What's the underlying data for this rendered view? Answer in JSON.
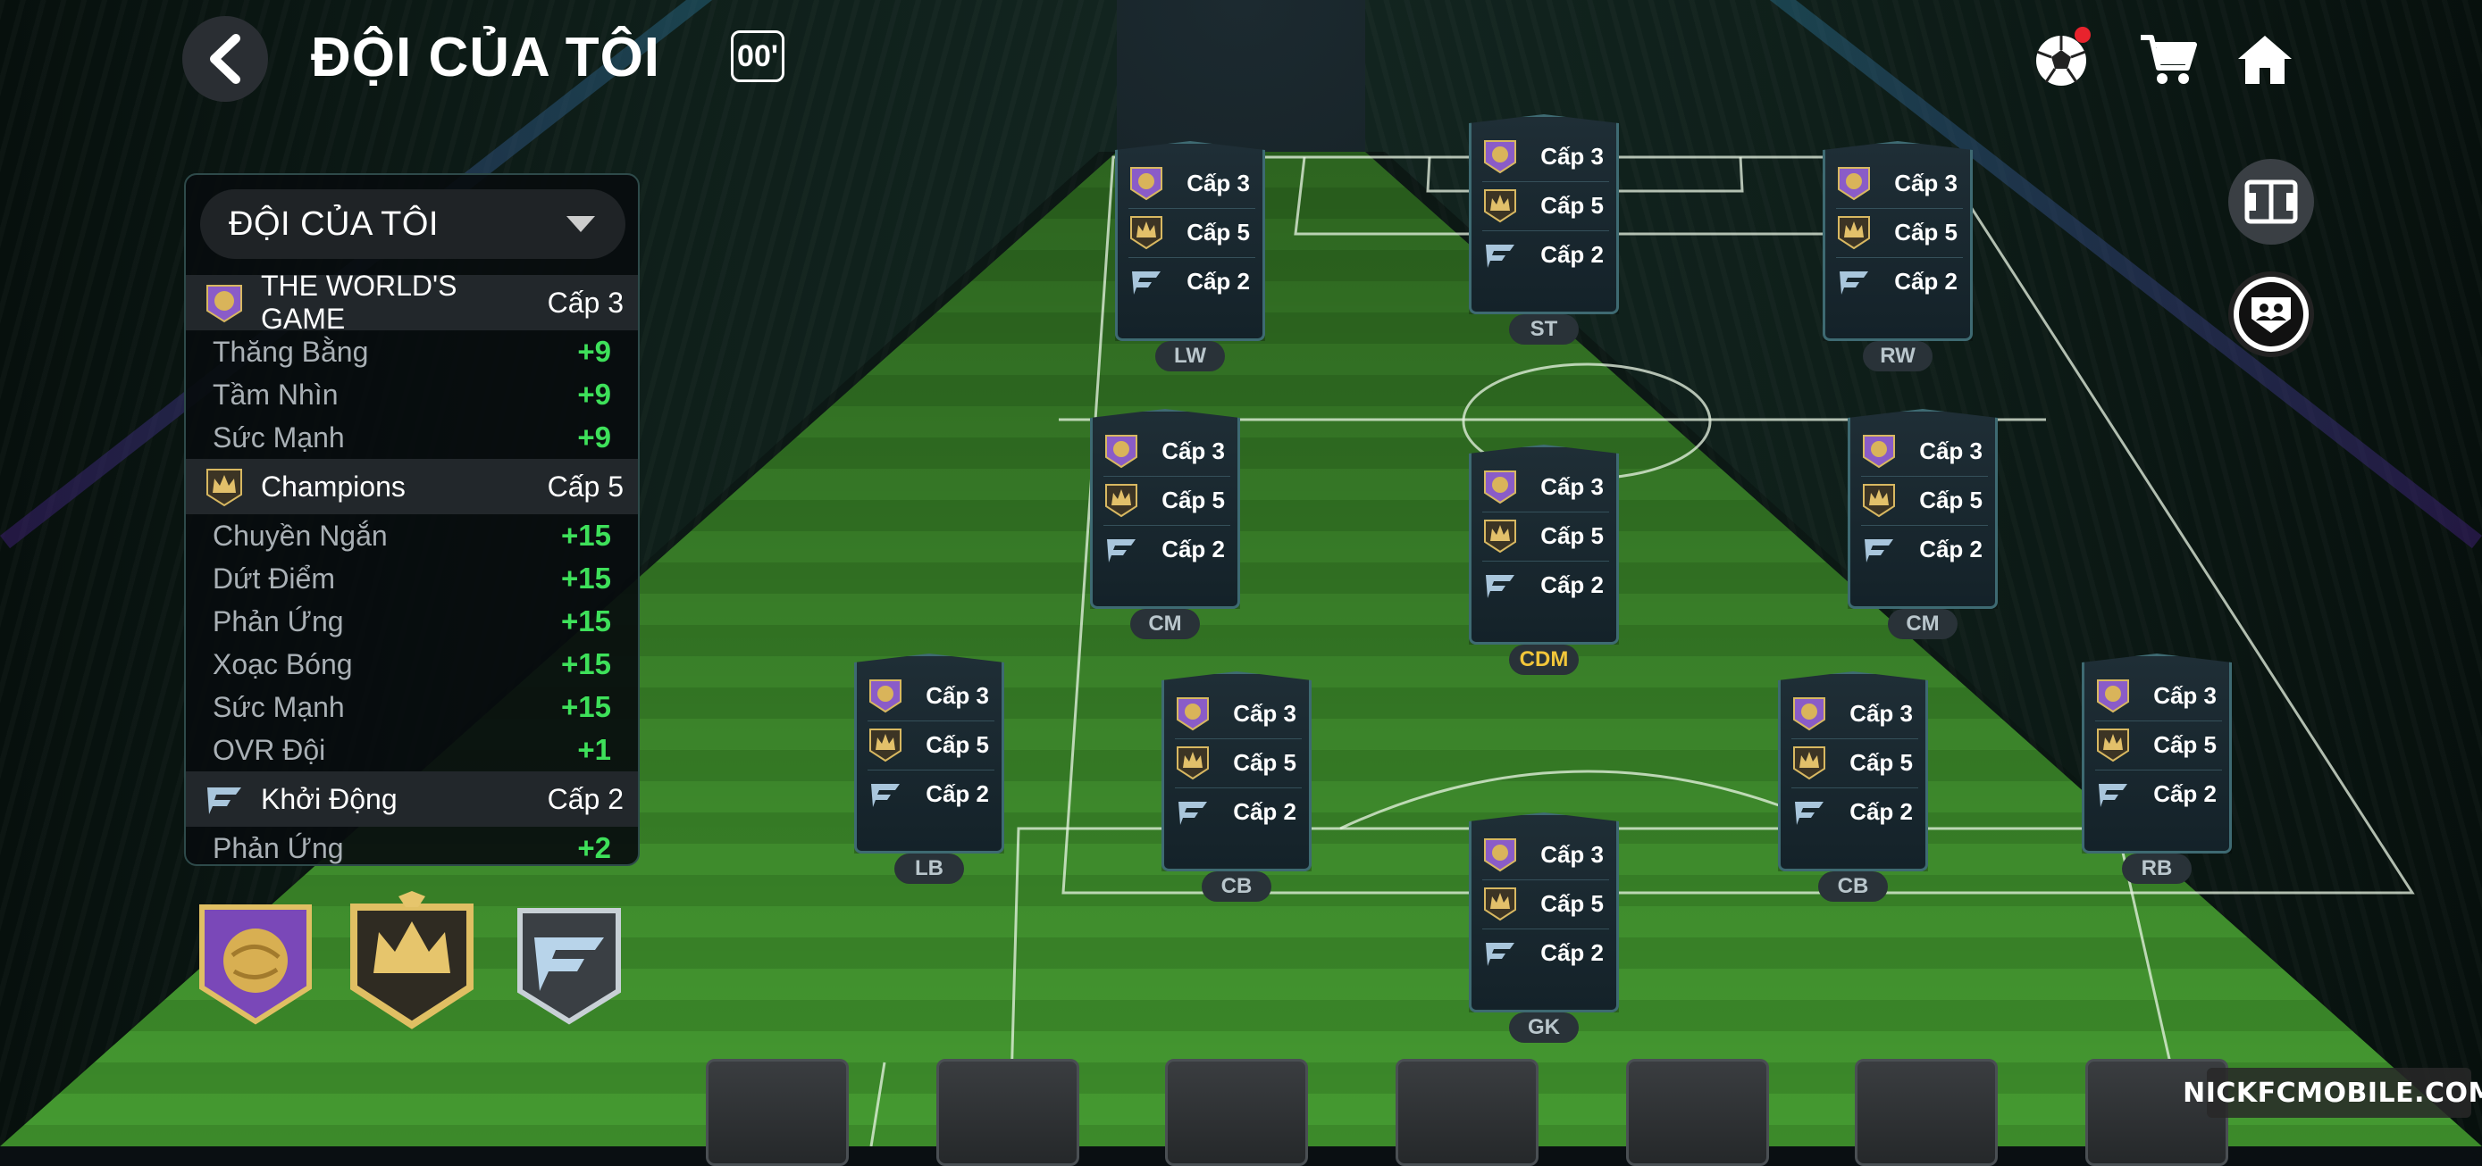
{
  "header": {
    "title": "ĐỘI CỦA TÔI",
    "badge": "00'"
  },
  "panel": {
    "dropdown_label": "ĐỘI CỦA TÔI",
    "perks": [
      {
        "name": "THE WORLD'S GAME",
        "level": "Cấp 3",
        "icon": "world-game-badge-icon",
        "stats": [
          {
            "name": "Thăng Bằng",
            "value": "+9"
          },
          {
            "name": "Tầm Nhìn",
            "value": "+9"
          },
          {
            "name": "Sức Mạnh",
            "value": "+9"
          }
        ]
      },
      {
        "name": "Champions",
        "level": "Cấp 5",
        "icon": "champions-crown-icon",
        "stats": [
          {
            "name": "Chuyền Ngắn",
            "value": "+15"
          },
          {
            "name": "Dứt Điểm",
            "value": "+15"
          },
          {
            "name": "Phản Ứng",
            "value": "+15"
          },
          {
            "name": "Xoạc Bóng",
            "value": "+15"
          },
          {
            "name": "Sức Mạnh",
            "value": "+15"
          },
          {
            "name": "OVR Đội",
            "value": "+1"
          }
        ]
      },
      {
        "name": "Khởi Động",
        "level": "Cấp 2",
        "icon": "fc-logo-icon",
        "stats": [
          {
            "name": "Phản Ứng",
            "value": "+2"
          }
        ]
      }
    ]
  },
  "card_levels": [
    "Cấp 3",
    "Cấp 5",
    "Cấp 2"
  ],
  "positions": {
    "lw": "LW",
    "st": "ST",
    "rw": "RW",
    "cm_left": "CM",
    "cdm": "CDM",
    "cm_right": "CM",
    "lb": "LB",
    "cb_left": "CB",
    "cb_right": "CB",
    "rb": "RB",
    "gk": "GK"
  },
  "watermark": "NICKFCMOBILE.COM",
  "colors": {
    "stat_positive": "#3ee05a",
    "cdm_highlight": "#f2c63a",
    "pitch_green": "#3f8f2c"
  }
}
